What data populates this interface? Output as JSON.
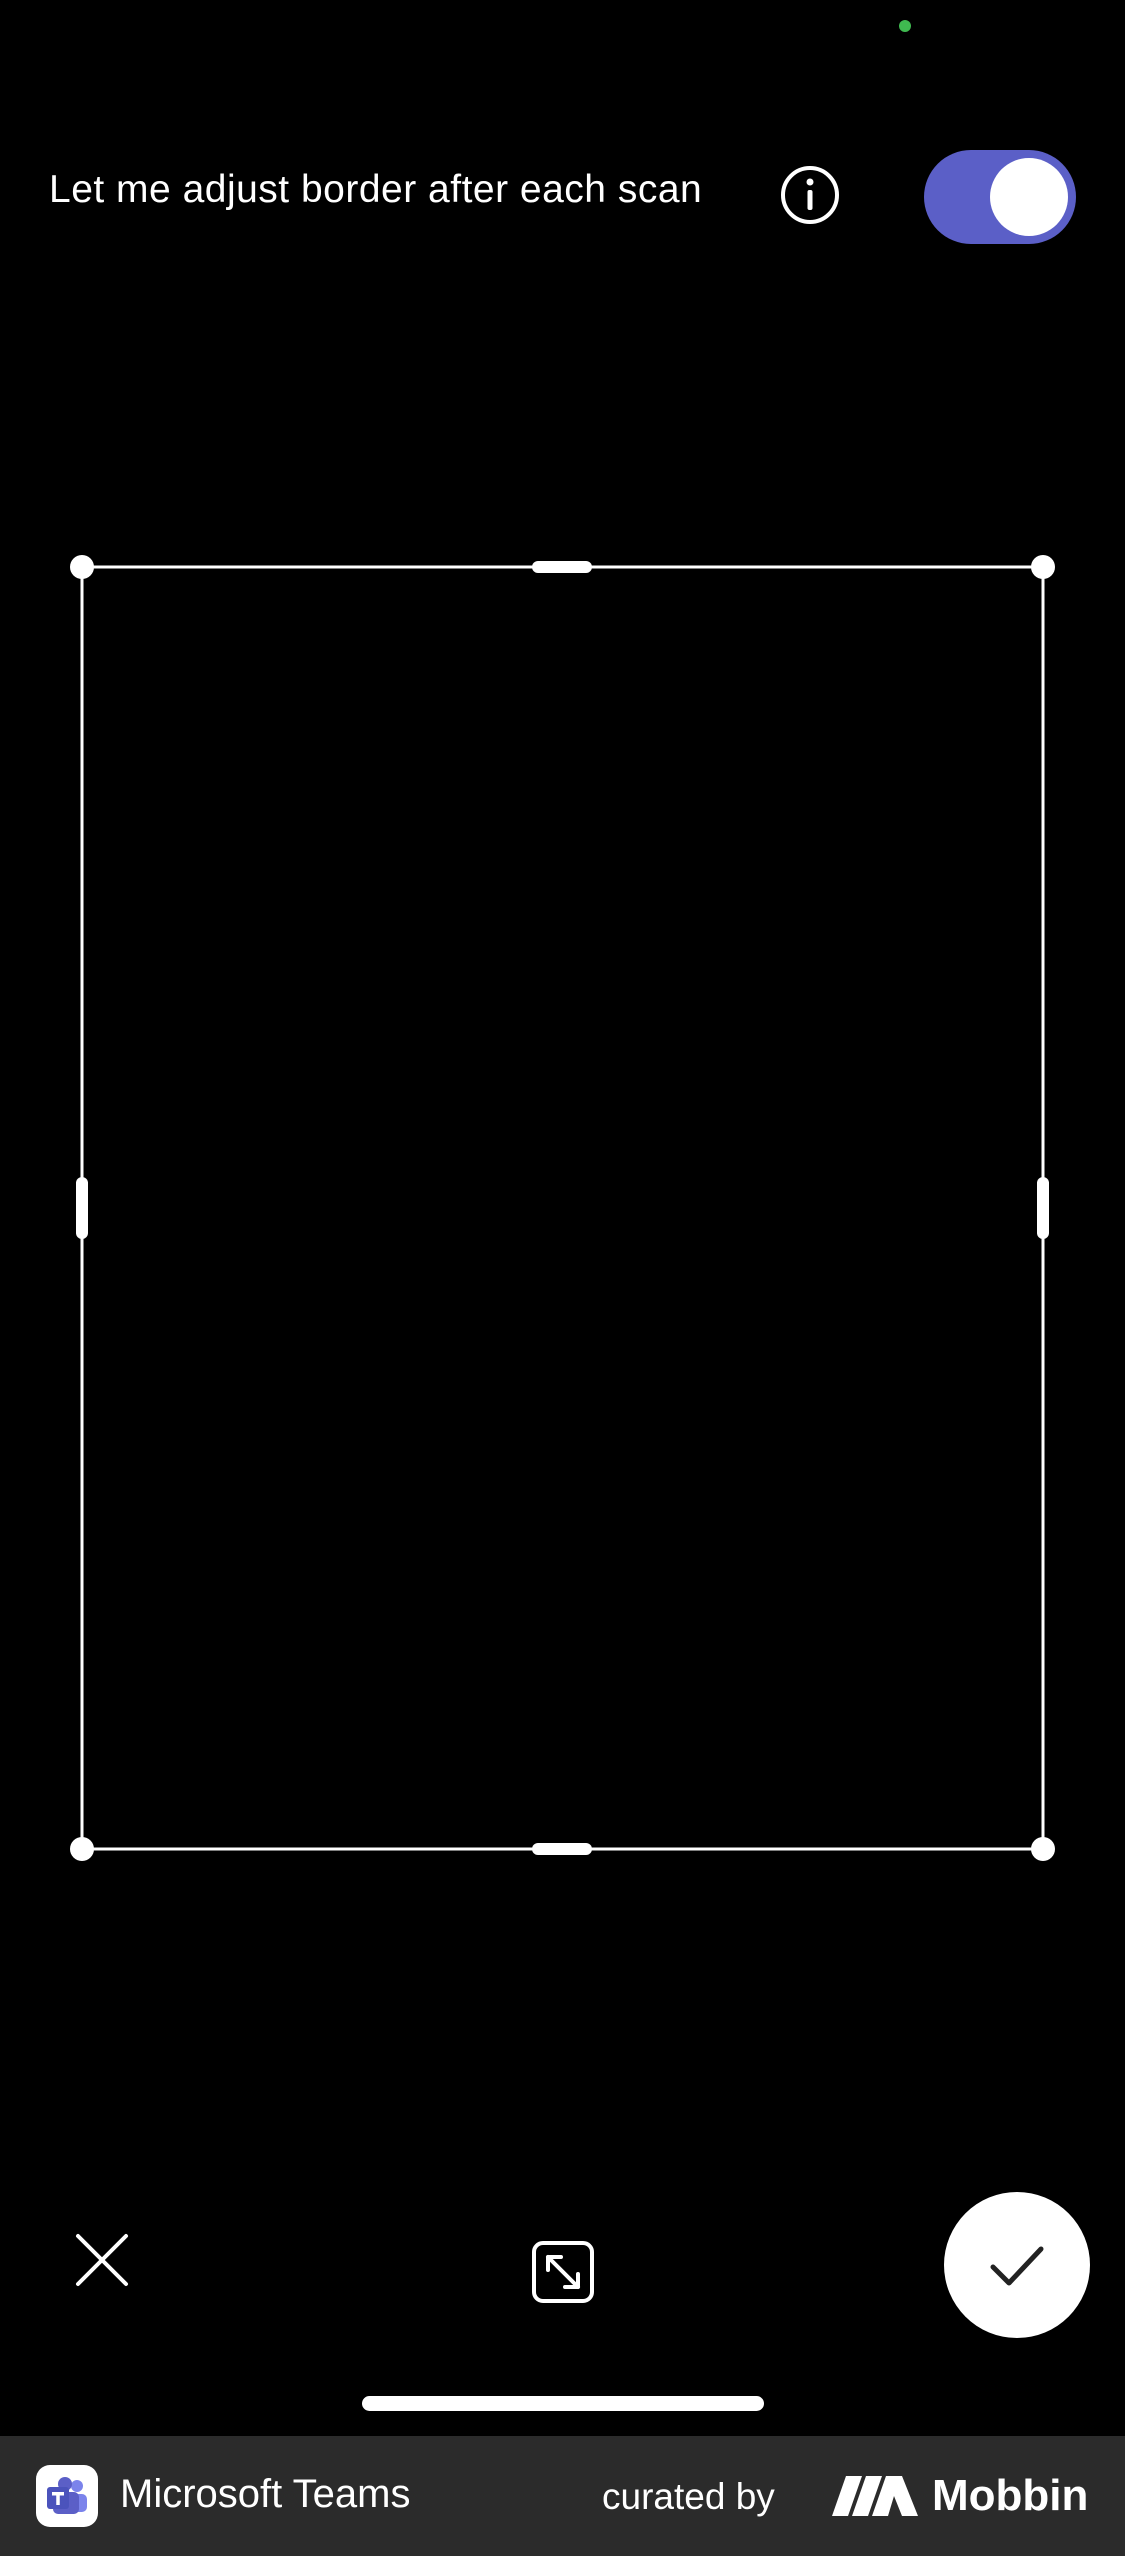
{
  "header": {
    "adjust_border_label": "Let me adjust border after each scan",
    "info_icon": "info-icon",
    "toggle_on": true,
    "toggle_color": "#5b5fc7"
  },
  "controls": {
    "close_icon": "close-icon",
    "expand_icon": "expand-icon",
    "confirm_icon": "checkmark-icon"
  },
  "footer": {
    "app_name": "Microsoft Teams",
    "curated_by": "curated by",
    "brand": "Mobbin"
  }
}
